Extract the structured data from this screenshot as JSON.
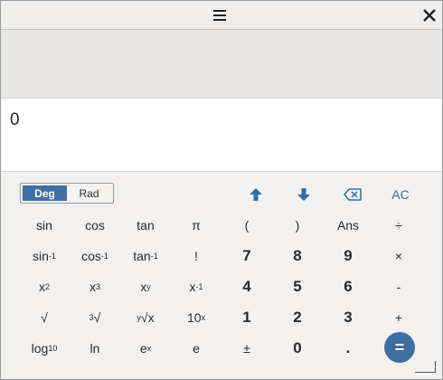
{
  "titlebar": {
    "menu_icon": "hamburger-icon",
    "close_icon": "close-icon"
  },
  "display": {
    "value": "0"
  },
  "mode": {
    "deg": "Deg",
    "rad": "Rad",
    "selected": "Deg"
  },
  "actions": {
    "up": "up-arrow-icon",
    "down": "down-arrow-icon",
    "backspace": "backspace-icon",
    "clear": "AC"
  },
  "keys": {
    "row1": [
      "sin",
      "cos",
      "tan",
      "π",
      "(",
      ")",
      "Ans",
      "÷"
    ],
    "row2": [
      "!",
      "7",
      "8",
      "9",
      "×"
    ],
    "row3": [
      "4",
      "5",
      "6",
      "-"
    ],
    "row4": [
      "√",
      "1",
      "2",
      "3",
      "+"
    ],
    "row5": [
      "ln",
      "e",
      "±",
      "0",
      "."
    ],
    "equals": "="
  }
}
